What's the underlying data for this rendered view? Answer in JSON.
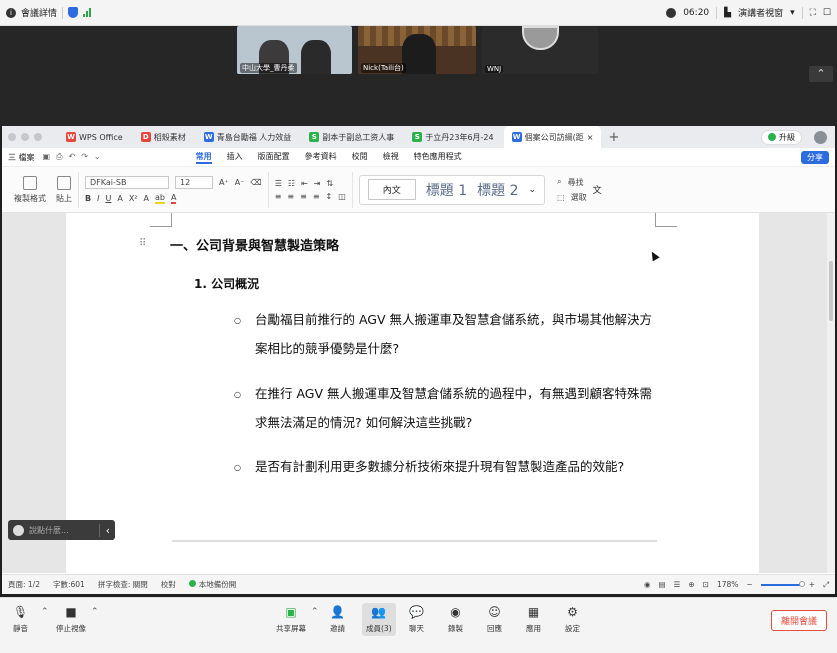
{
  "topbar": {
    "meeting_info": "會議詳情",
    "time": "06:20",
    "speaker_view": "演講者視窗"
  },
  "videos": [
    {
      "name": "中山大學_曹丹柔"
    },
    {
      "name": "Nick(Taili台)"
    },
    {
      "name": "WNJ"
    }
  ],
  "wps": {
    "tabs": [
      {
        "label": "WPS Office",
        "icon_color": "#e8453c",
        "icon": "W"
      },
      {
        "label": "稻殼素材",
        "icon_color": "#e8453c",
        "icon": "D"
      },
      {
        "label": "青島台勵福 人力效益",
        "icon_color": "#2d6cdf",
        "icon": "W"
      },
      {
        "label": "副本于副总工资人事",
        "icon_color": "#2bb24c",
        "icon": "S"
      },
      {
        "label": "于立丹23年6月-24",
        "icon_color": "#2bb24c",
        "icon": "S"
      },
      {
        "label": "個案公司訪綱(距",
        "icon_color": "#2d6cdf",
        "icon": "W"
      }
    ],
    "upgrade": "升級",
    "menu_file": "三 檔案",
    "menus": [
      "常用",
      "插入",
      "版面配置",
      "參考資料",
      "校閱",
      "檢視",
      "特色應用程式"
    ],
    "share": "分享",
    "ribbon": {
      "copy_format": "複製格式",
      "paste": "貼上",
      "font": "DFKai-SB",
      "size": "12",
      "style_normal": "內文",
      "style_h1": "標題 1",
      "style_h2": "標題 2",
      "find": "尋找",
      "select": "選取",
      "more": "文"
    }
  },
  "document": {
    "heading1": "一、公司背景與智慧製造策略",
    "heading2": "1.  公司概況",
    "bullets": [
      "台勵福目前推行的 AGV 無人搬運車及智慧倉儲系統，與市場其他解決方案相比的競爭優勢是什麼?",
      "在推行 AGV 無人搬運車及智慧倉儲系統的過程中，有無遇到顧客特殊需求無法滿足的情況? 如何解決這些挑戰?",
      "是否有計劃利用更多數據分析技術來提升現有智慧製造產品的效能?"
    ],
    "chat_placeholder": "說點什麼..."
  },
  "status": {
    "page": "頁面: 1/2",
    "words": "字數:601",
    "spell": "拼字檢查: 關閉",
    "proof": "校對",
    "backup": "本地備份開",
    "zoom": "178%"
  },
  "controls": {
    "mute": "靜音",
    "stop_video": "停止視像",
    "share_screen": "共享屏幕",
    "invite": "邀請",
    "members": "成員(3)",
    "chat": "聊天",
    "record": "錄製",
    "reactions": "回應",
    "apps": "應用",
    "settings": "設定",
    "end": "離開會議"
  }
}
